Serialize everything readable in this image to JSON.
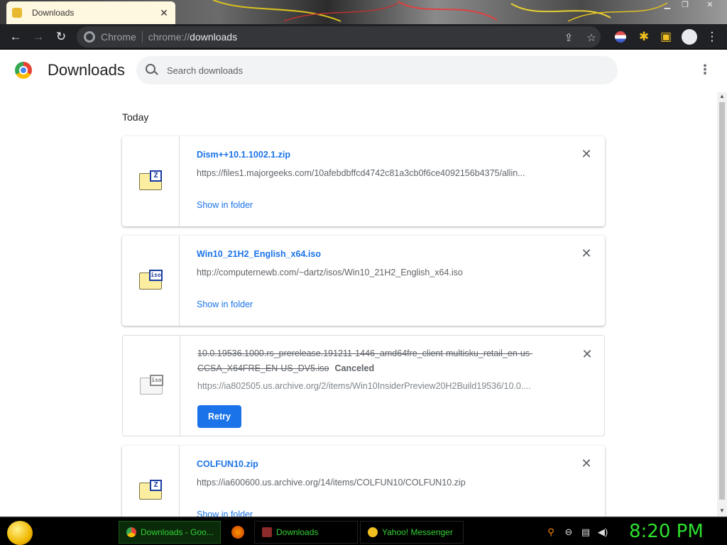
{
  "browser": {
    "tab_title": "Downloads",
    "tab_close": "✕",
    "omnibox_site": "Chrome",
    "url_scheme": "chrome://",
    "url_host": "downloads"
  },
  "page": {
    "title": "Downloads",
    "search_placeholder": "Search downloads",
    "day_label": "Today"
  },
  "downloads": [
    {
      "name": "Dism++10.1.1002.1.zip",
      "url": "https://files1.majorgeeks.com/10afebdbffcd4742c81a3cb0f6ce4092156b4375/allin...",
      "action": "Show in folder",
      "icon_badge": "Z",
      "icon_name": "zip-file-icon"
    },
    {
      "name": "Win10_21H2_English_x64.iso",
      "url": "http://computernewb.com/~dartz/isos/Win10_21H2_English_x64.iso",
      "action": "Show in folder",
      "icon_badge": "iso",
      "icon_name": "iso-file-icon"
    },
    {
      "name": "10.0.19536.1000.rs_prerelease.191211-1446_amd64fre_client-multisku_retail_en-us-CCSA_X64FRE_EN-US_DV5.iso",
      "status": "Canceled",
      "url": "https://ia802505.us.archive.org/2/items/Win10InsiderPreview20H2Build19536/10.0....",
      "action": "Retry",
      "icon_badge": "iso",
      "icon_name": "iso-file-icon"
    },
    {
      "name": "COLFUN10.zip",
      "url": "https://ia600600.us.archive.org/14/items/COLFUN10/COLFUN10.zip",
      "action": "Show in folder",
      "icon_badge": "Z",
      "icon_name": "zip-file-icon"
    }
  ],
  "taskbar": {
    "tasks": [
      "Downloads - Goo...",
      "Downloads",
      "Yahoo! Messenger"
    ],
    "clock": "8:20 PM"
  },
  "colors": {
    "link_blue": "#1a73e8",
    "clock_green": "#2ee02e"
  }
}
